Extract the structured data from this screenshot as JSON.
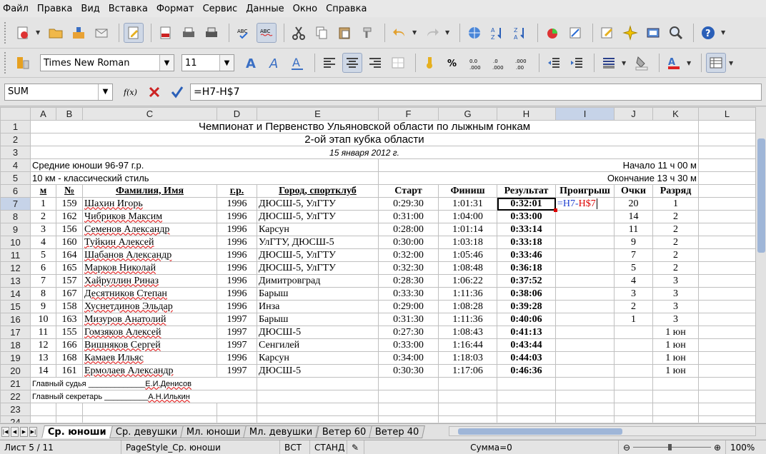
{
  "menu": [
    "Файл",
    "Правка",
    "Вид",
    "Вставка",
    "Формат",
    "Сервис",
    "Данные",
    "Окно",
    "Справка"
  ],
  "format": {
    "font": "Times New Roman",
    "size": "11"
  },
  "formula_bar": {
    "cell_ref": "SUM",
    "content": "=H7-H$7",
    "fx": "f(x)"
  },
  "columns": [
    "A",
    "B",
    "C",
    "D",
    "E",
    "F",
    "G",
    "H",
    "I",
    "J",
    "K",
    "L"
  ],
  "sheet": {
    "title1": "Чемпионат и Первенство Ульяновской области по лыжным гонкам",
    "title2": "2-ой этап кубка области",
    "date": "15 января 2012 г.",
    "group": "Средние юноши 96-97 г.р.",
    "start_time": "Начало 11 ч 00 м",
    "distance": "10 км - классический стиль",
    "end_time": "Окончание 13 ч 30 м",
    "headers": [
      "м",
      "№",
      "Фамилия, Имя",
      "г.р.",
      "Город, спортклуб",
      "Старт",
      "Финиш",
      "Результат",
      "Проигрыш",
      "Очки",
      "Разряд"
    ],
    "edit_formula_a": "=H7-",
    "edit_formula_b": "H$7",
    "rows": [
      [
        "1",
        "159",
        "Шахин Игорь",
        "1996",
        "ДЮСШ-5, УлГТУ",
        "0:29:30",
        "1:01:31",
        "0:32:01",
        "",
        "20",
        "1"
      ],
      [
        "2",
        "162",
        "Чибриков Максим",
        "1996",
        "ДЮСШ-5, УлГТУ",
        "0:31:00",
        "1:04:00",
        "0:33:00",
        "",
        "14",
        "2"
      ],
      [
        "3",
        "156",
        "Семенов Александр",
        "1996",
        "Карсун",
        "0:28:00",
        "1:01:14",
        "0:33:14",
        "",
        "11",
        "2"
      ],
      [
        "4",
        "160",
        "Туйкин Алексей",
        "1996",
        "УлГТУ, ДЮСШ-5",
        "0:30:00",
        "1:03:18",
        "0:33:18",
        "",
        "9",
        "2"
      ],
      [
        "5",
        "164",
        "Шабанов Александр",
        "1996",
        "ДЮСШ-5, УлГТУ",
        "0:32:00",
        "1:05:46",
        "0:33:46",
        "",
        "7",
        "2"
      ],
      [
        "6",
        "165",
        "Марков Николай",
        "1996",
        "ДЮСШ-5, УлГТУ",
        "0:32:30",
        "1:08:48",
        "0:36:18",
        "",
        "5",
        "2"
      ],
      [
        "7",
        "157",
        "Хайруллин Риназ",
        "1996",
        "Димитровград",
        "0:28:30",
        "1:06:22",
        "0:37:52",
        "",
        "4",
        "3"
      ],
      [
        "8",
        "167",
        "Десятников Степан",
        "1996",
        "Барыш",
        "0:33:30",
        "1:11:36",
        "0:38:06",
        "",
        "3",
        "3"
      ],
      [
        "9",
        "158",
        "Хуснетдинов Эльдар",
        "1996",
        "Инза",
        "0:29:00",
        "1:08:28",
        "0:39:28",
        "",
        "2",
        "3"
      ],
      [
        "10",
        "163",
        "Мизуров Анатолий",
        "1997",
        "Барыш",
        "0:31:30",
        "1:11:36",
        "0:40:06",
        "",
        "1",
        "3"
      ],
      [
        "11",
        "155",
        "Гомзяков Алексей",
        "1997",
        "ДЮСШ-5",
        "0:27:30",
        "1:08:43",
        "0:41:13",
        "",
        "",
        "1 юн"
      ],
      [
        "12",
        "166",
        "Вишняков Сергей",
        "1997",
        "Сенгилей",
        "0:33:00",
        "1:16:44",
        "0:43:44",
        "",
        "",
        "1 юн"
      ],
      [
        "13",
        "168",
        "Камаев Ильяс",
        "1996",
        "Карсун",
        "0:34:00",
        "1:18:03",
        "0:44:03",
        "",
        "",
        "1 юн"
      ],
      [
        "14",
        "161",
        "Ермолаев Александр",
        "1997",
        "ДЮСШ-5",
        "0:30:30",
        "1:17:06",
        "0:46:36",
        "",
        "",
        "1 юн"
      ]
    ],
    "judge_label": "Главный судья _____________",
    "judge_name": "Е.И.Денисов",
    "secretary_label": "Главный секретарь __________",
    "secretary_name": "А.Н.Илькин"
  },
  "tabs": [
    "Ср. юноши",
    "Ср. девушки",
    "Мл. юноши",
    "Мл. девушки",
    "Ветер 60",
    "Ветер 40"
  ],
  "status": {
    "sheet": "Лист 5 / 11",
    "style": "PageStyle_Ср. юноши",
    "mode1": "ВСТ",
    "mode2": "СТАНД",
    "sum": "Сумма=0",
    "zoom": "100%"
  },
  "colors": {
    "accent": "#9fb6d8",
    "formula_ref_blue": "#1f3fd0",
    "formula_ref_red": "#d00000"
  }
}
